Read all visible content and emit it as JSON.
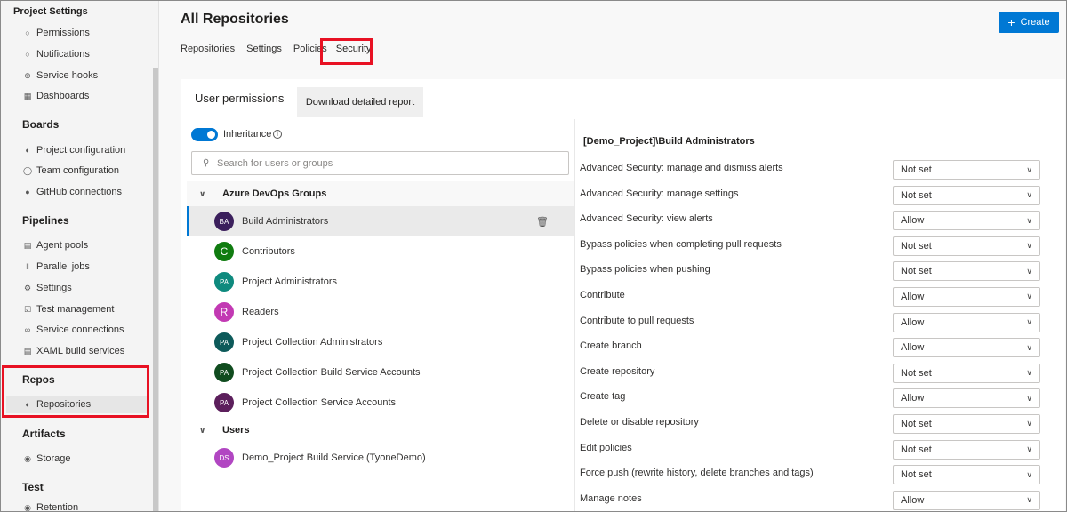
{
  "sidebar": {
    "title": "Project Settings",
    "sections": [
      {
        "heading": null,
        "items": [
          {
            "label": "Permissions",
            "icon": "lock-icon"
          },
          {
            "label": "Notifications",
            "icon": "chat-icon"
          },
          {
            "label": "Service hooks",
            "icon": "plug-icon"
          },
          {
            "label": "Dashboards",
            "icon": "grid-icon"
          }
        ]
      },
      {
        "heading": "Boards",
        "items": [
          {
            "label": "Project configuration",
            "icon": "config-icon"
          },
          {
            "label": "Team configuration",
            "icon": "team-icon"
          },
          {
            "label": "GitHub connections",
            "icon": "github-icon"
          }
        ]
      },
      {
        "heading": "Pipelines",
        "items": [
          {
            "label": "Agent pools",
            "icon": "agent-icon"
          },
          {
            "label": "Parallel jobs",
            "icon": "parallel-icon"
          },
          {
            "label": "Settings",
            "icon": "gear-icon"
          },
          {
            "label": "Test management",
            "icon": "test-icon"
          },
          {
            "label": "Service connections",
            "icon": "connection-icon"
          },
          {
            "label": "XAML build services",
            "icon": "build-icon"
          }
        ]
      },
      {
        "heading": "Repos",
        "items": [
          {
            "label": "Repositories",
            "icon": "repo-icon"
          }
        ]
      },
      {
        "heading": "Artifacts",
        "items": [
          {
            "label": "Storage",
            "icon": "storage-icon"
          }
        ]
      },
      {
        "heading": "Test",
        "items": [
          {
            "label": "Retention",
            "icon": "retention-icon"
          }
        ]
      }
    ]
  },
  "header": {
    "title": "All Repositories",
    "create_label": "Create",
    "tabs": [
      "Repositories",
      "Settings",
      "Policies",
      "Security"
    ],
    "active_tab": "Security"
  },
  "panel": {
    "title": "User permissions",
    "download_label": "Download detailed report",
    "inheritance_label": "Inheritance",
    "search_placeholder": "Search for users or groups",
    "groups_heading": "Azure DevOps Groups",
    "users_heading": "Users",
    "groups": [
      {
        "initials": "BA",
        "name": "Build Administrators",
        "color": "#3b1f5c",
        "selected": true
      },
      {
        "initials": "C",
        "name": "Contributors",
        "color": "#107c10",
        "selected": false
      },
      {
        "initials": "PA",
        "name": "Project Administrators",
        "color": "#0e8a7e",
        "selected": false
      },
      {
        "initials": "R",
        "name": "Readers",
        "color": "#c239b3",
        "selected": false
      },
      {
        "initials": "PA",
        "name": "Project Collection Administrators",
        "color": "#0d5a5a",
        "selected": false
      },
      {
        "initials": "PA",
        "name": "Project Collection Build Service Accounts",
        "color": "#104c1f",
        "selected": false
      },
      {
        "initials": "PA",
        "name": "Project Collection Service Accounts",
        "color": "#5c1f5c",
        "selected": false
      }
    ],
    "users": [
      {
        "initials": "DS",
        "name": "Demo_Project Build Service (TyoneDemo)",
        "color": "#b146c2"
      }
    ]
  },
  "permissions": {
    "group_title": "[Demo_Project]\\Build Administrators",
    "items": [
      {
        "name": "Advanced Security: manage and dismiss alerts",
        "value": "Not set"
      },
      {
        "name": "Advanced Security: manage settings",
        "value": "Not set"
      },
      {
        "name": "Advanced Security: view alerts",
        "value": "Allow"
      },
      {
        "name": "Bypass policies when completing pull requests",
        "value": "Not set"
      },
      {
        "name": "Bypass policies when pushing",
        "value": "Not set"
      },
      {
        "name": "Contribute",
        "value": "Allow"
      },
      {
        "name": "Contribute to pull requests",
        "value": "Allow"
      },
      {
        "name": "Create branch",
        "value": "Allow"
      },
      {
        "name": "Create repository",
        "value": "Not set"
      },
      {
        "name": "Create tag",
        "value": "Allow"
      },
      {
        "name": "Delete or disable repository",
        "value": "Not set"
      },
      {
        "name": "Edit policies",
        "value": "Not set"
      },
      {
        "name": "Force push (rewrite history, delete branches and tags)",
        "value": "Not set"
      },
      {
        "name": "Manage notes",
        "value": "Allow"
      }
    ]
  },
  "colors": {
    "accent": "#0078d4",
    "highlight": "#e81123"
  }
}
